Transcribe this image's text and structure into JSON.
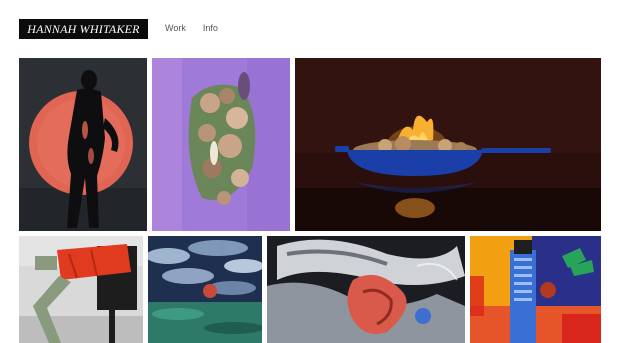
{
  "header": {
    "logo_text": "HANNAH WHITAKER",
    "nav": [
      {
        "label": "Work"
      },
      {
        "label": "Info"
      }
    ]
  },
  "gallery": {
    "tiles": [
      {
        "name": "silhouette-figure-photo",
        "colors": {
          "bg": "#2c2f34",
          "disc": "#e06552",
          "figure": "#0e0e10"
        }
      },
      {
        "name": "mushroom-still-life-photo",
        "colors": {
          "bg": "#a07ad8",
          "accent": "#6b9a44",
          "item": "#c8a588"
        }
      },
      {
        "name": "cast-iron-pan-fire-photo",
        "colors": {
          "bg": "#2a0f0d",
          "pan": "#1b3fa8",
          "flame": "#f29a2a"
        }
      },
      {
        "name": "red-skirt-mannequin-photo",
        "colors": {
          "bg": "#d9d9d9",
          "skirt": "#e03a1f",
          "leg": "#8a9a7e"
        }
      },
      {
        "name": "cloud-landscape-photo",
        "colors": {
          "sky": "#1e2f4f",
          "cloud": "#9fb4cf",
          "sea": "#2c7a67"
        }
      },
      {
        "name": "abstract-chrome-sculpture-photo",
        "colors": {
          "bg": "#1b1d22",
          "chrome": "#cfd3d8",
          "accent": "#d95a4a"
        }
      },
      {
        "name": "blue-tower-collage-photo",
        "colors": {
          "bg": "#f2a012",
          "tower": "#3a6fd6",
          "accent": "#27a35a"
        }
      }
    ]
  }
}
